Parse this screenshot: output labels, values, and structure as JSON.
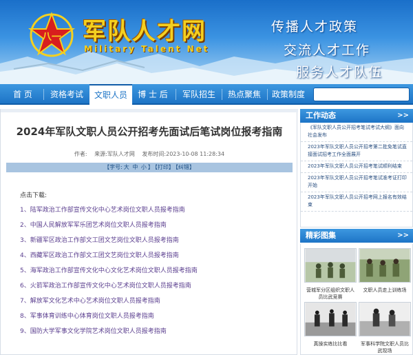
{
  "header": {
    "logo_cn": "军队人才网",
    "logo_en": "Military Talent Net",
    "slogans": [
      "传播人才政策",
      "交流人才工作",
      "服务人才队伍"
    ]
  },
  "nav": {
    "items": [
      "首 页",
      "资格考试",
      "文职人员",
      "博 士 后",
      "军队招生",
      "热点聚焦",
      "政策制度"
    ],
    "active_index": 2,
    "search_value": ""
  },
  "article": {
    "title": "2024年军队文职人员公开招考先面试后笔试岗位报考指南",
    "author_label": "作者:",
    "source": "来源:军队人才网",
    "publish_time": "发布时间:2023-10-08 11:28:34",
    "tools": [
      "【字号:",
      "大",
      "中",
      "小",
      "】",
      "【打印】",
      "【纠错】"
    ],
    "download_label": "点击下载:",
    "downloads": [
      "1、陆军政治工作部宣传文化中心艺术岗位文职人员报考指南",
      "2、中国人民解放军军乐团艺术岗位文职人员报考指南",
      "3、新疆军区政治工作部文工团文艺岗位文职人员报考指南",
      "4、西藏军区政治工作部文工团文艺岗位文职人员报考指南",
      "5、海军政治工作部宣传文化中心文化艺术岗位文职人员报考指南",
      "6、火箭军政治工作部宣传文化中心艺术岗位文职人员报考指南",
      "7、解放军文化艺术中心艺术岗位文职人员报考指南",
      "8、军事体育训练中心体育岗位文职人员报考指南",
      "9、国防大学军事文化学院艺术岗位文职人员报考指南"
    ]
  },
  "sidebar": {
    "news_title": "工作动态",
    "more_label": ">>",
    "news": [
      "《军队文职人员公开招考笔试考试大纲》面向社会发布",
      "2023年军队文职人员公开招考第二批免笔试直接面试招考工作全面展开",
      "2023年军队文职人员公开招考笔试顺利结束",
      "2023年军队文职人员公开招考笔试准考证打印开始",
      "2023年军队文职人员公开招考网上报名有效结束"
    ],
    "gallery_title": "精彩图集",
    "gallery": [
      "营城军分区组织文职人员比武竞赛",
      "文职人员走上训练场",
      "真操实练比比看",
      "军事科学院文职人员比武现场"
    ]
  }
}
